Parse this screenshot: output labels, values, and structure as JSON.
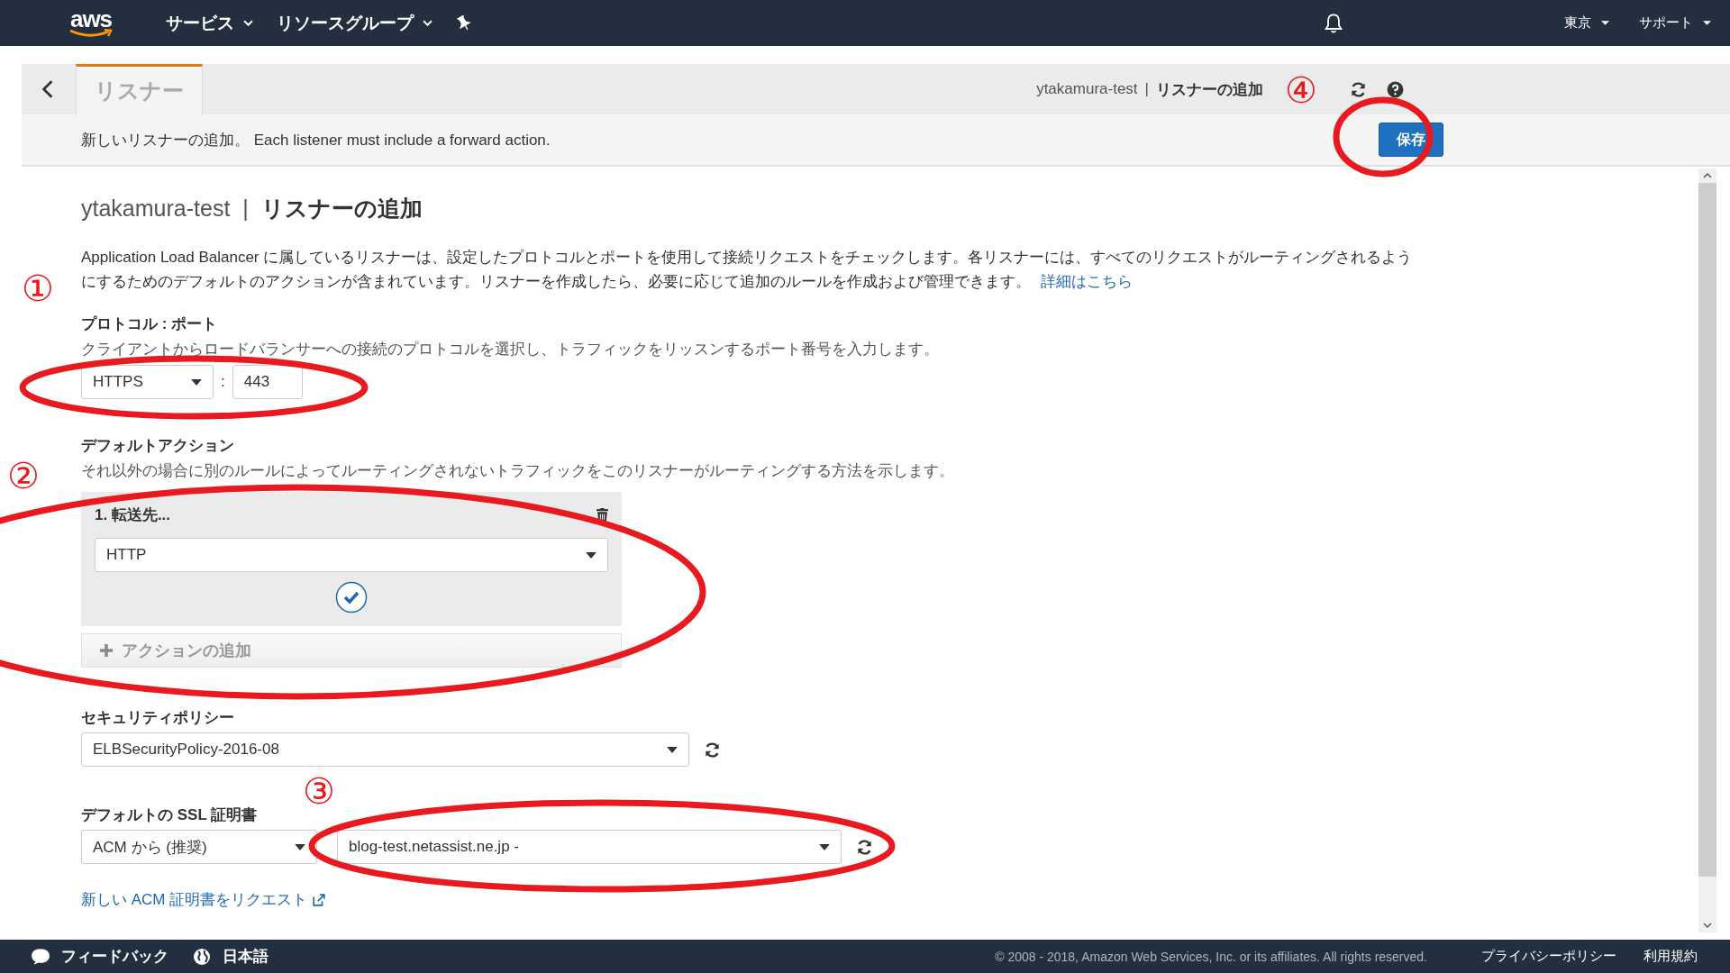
{
  "top_nav": {
    "logo": "aws",
    "menus": [
      {
        "label": "サービス"
      },
      {
        "label": "リソースグループ"
      }
    ],
    "region": "東京",
    "support": "サポート"
  },
  "subheader": {
    "tabs": [
      {
        "label": "リスナー",
        "selected": true
      }
    ],
    "lb_name": "ytakamura-test",
    "separator": "|",
    "page": "リスナーの追加"
  },
  "info_bar": {
    "message": "新しいリスナーの追加。 Each listener must include a forward action.",
    "save_button": "保存"
  },
  "content": {
    "lb_name": "ytakamura-test",
    "separator": "|",
    "title": "リスナーの追加",
    "description": "Application Load Balancer に属しているリスナーは、設定したプロトコルとポートを使用して接続リクエストをチェックします。各リスナーには、すべてのリクエストがルーティングされるようにするためのデフォルトのアクションが含まれています。リスナーを作成したら、必要に応じて追加のルールを作成および管理できます。",
    "learn_more": "詳細はこちら"
  },
  "protocol_port": {
    "label": "プロトコル : ポート",
    "hint": "クライアントからロードバランサーへの接続のプロトコルを選択し、トラフィックをリッスンするポート番号を入力します。",
    "protocol": "HTTPS",
    "colon": ":",
    "port": "443"
  },
  "default_action": {
    "label": "デフォルトアクション",
    "hint": "それ以外の場合に別のルールによってルーティングされないトラフィックをこのリスナーがルーティングする方法を示します。",
    "actions": [
      {
        "title": "1. 転送先...",
        "value": "HTTP"
      }
    ],
    "add_action": "アクションの追加"
  },
  "security_policy": {
    "label": "セキュリティポリシー",
    "value": "ELBSecurityPolicy-2016-08"
  },
  "ssl_certificate": {
    "label": "デフォルトの SSL 証明書",
    "source": "ACM から (推奨)",
    "certificate": "blog-test.netassist.ne.jp -",
    "request_link": "新しい ACM 証明書をリクエスト"
  },
  "footer": {
    "feedback": "フィードバック",
    "language": "日本語",
    "copyright": "© 2008 - 2018, Amazon Web Services, Inc. or its affiliates. All rights reserved.",
    "links": [
      "プライバシーポリシー",
      "利用規約"
    ]
  },
  "annotations": [
    {
      "label": "①"
    },
    {
      "label": "②"
    },
    {
      "label": "③"
    },
    {
      "label": "④"
    }
  ]
}
